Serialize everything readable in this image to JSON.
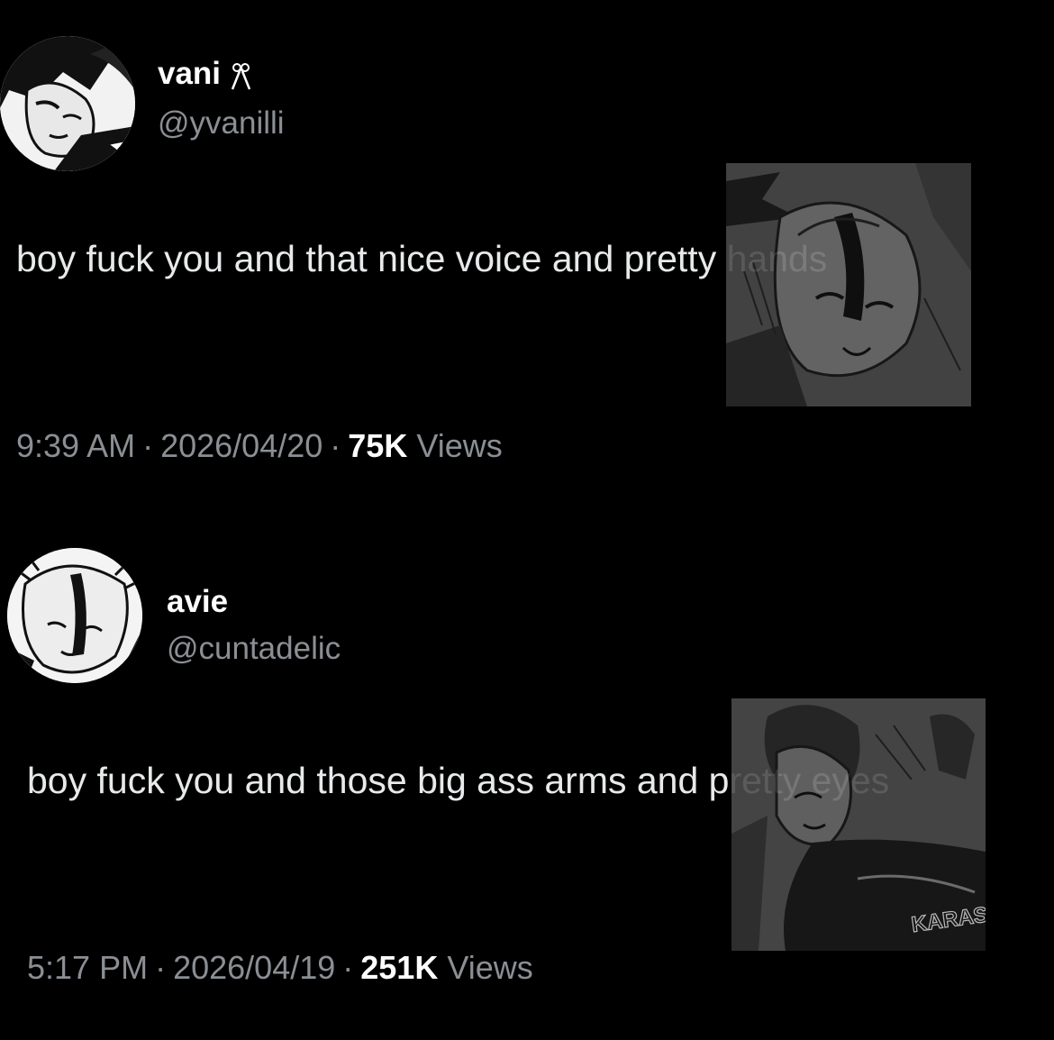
{
  "tweets": [
    {
      "display_name": "vani",
      "name_emoji": "ribbon-emoji",
      "handle": "@yvanilli",
      "text": "boy fuck you and that nice voice and pretty hands",
      "time": "9:39 AM",
      "date": "2026/04/20",
      "views_count": "75K",
      "views_label": "Views"
    },
    {
      "display_name": "avie",
      "handle": "@cuntadelic",
      "text": "boy fuck you and those big ass arms and pretty eyes",
      "time": "5:17 PM",
      "date": "2026/04/19",
      "views_count": "251K",
      "views_label": "Views"
    }
  ],
  "separator": "·",
  "images": {
    "tweet1_panel_lettering": "",
    "tweet2_panel_lettering": "KARAS"
  },
  "colors": {
    "background": "#000000",
    "text": "#e7e9ea",
    "secondary": "#8b8f94",
    "name": "#ffffff"
  }
}
